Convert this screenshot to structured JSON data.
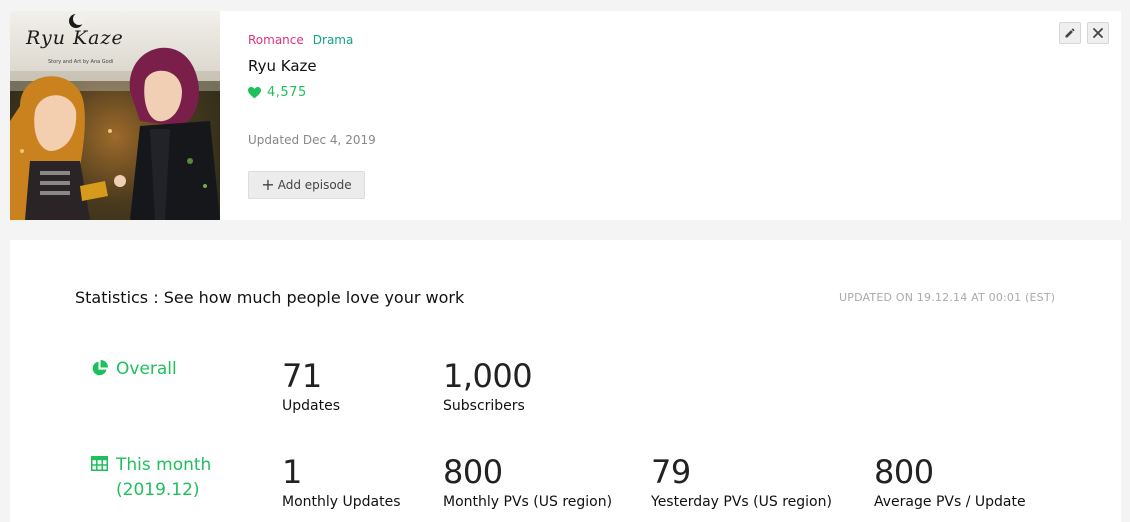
{
  "series": {
    "cover": {
      "title": "Ryu Kaze",
      "subtitle": "Story and Art by Ana Godi"
    },
    "genres": [
      "Romance",
      "Drama"
    ],
    "title": "Ryu Kaze",
    "likes": "4,575",
    "updated": "Updated Dec 4, 2019",
    "add_episode_label": "Add episode",
    "icons": {
      "edit": "pencil-icon",
      "close": "close-icon",
      "like": "heart-icon",
      "add": "plus-icon"
    }
  },
  "statistics": {
    "title": "Statistics : See how much people love your work",
    "updated_on": "UPDATED ON 19.12.14 AT 00:01 (EST)",
    "overall": {
      "label": "Overall",
      "icon": "pie-chart-icon",
      "items": [
        {
          "value": "71",
          "label": "Updates"
        },
        {
          "value": "1,000",
          "label": "Subscribers"
        }
      ]
    },
    "this_month": {
      "label_line1": "This month",
      "label_line2": "(2019.12)",
      "icon": "calendar-grid-icon",
      "items": [
        {
          "value": "1",
          "label": "Monthly Updates"
        },
        {
          "value": "800",
          "label": "Monthly PVs (US region)"
        },
        {
          "value": "79",
          "label": "Yesterday PVs (US region)"
        },
        {
          "value": "800",
          "label": "Average PVs / Update"
        }
      ]
    }
  },
  "colors": {
    "accent_green": "#1fbf5e",
    "romance": "#e0337a",
    "drama": "#14a37f"
  }
}
